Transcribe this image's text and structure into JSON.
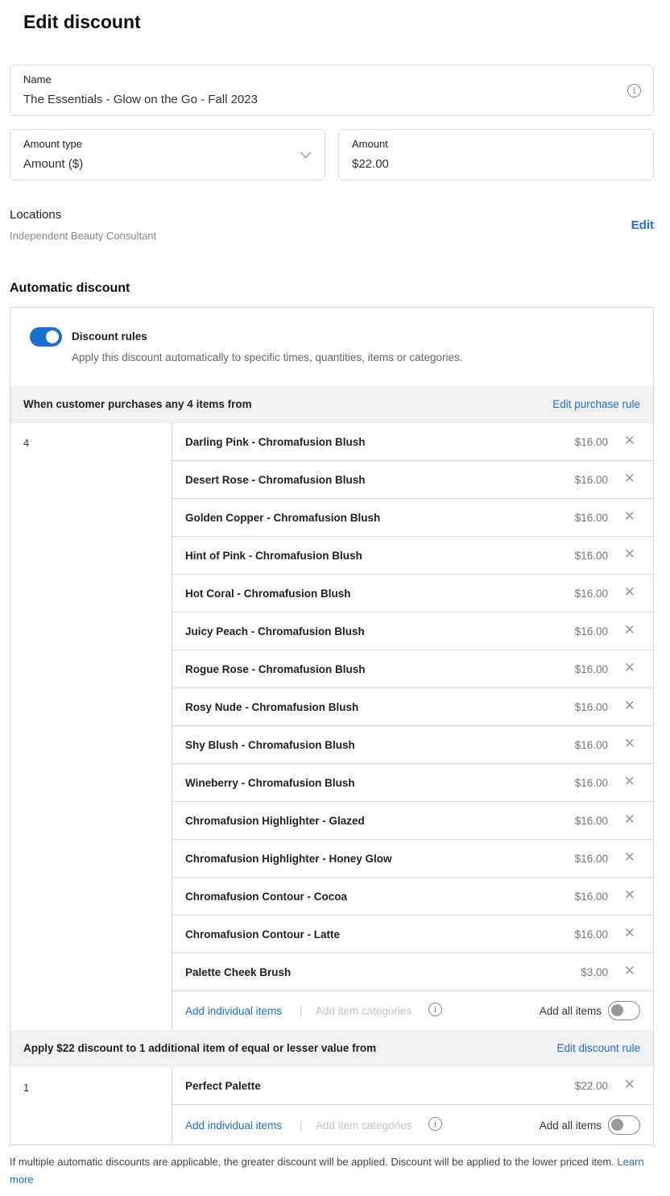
{
  "page": {
    "title": "Edit discount"
  },
  "name_field": {
    "label": "Name",
    "value": "The Essentials - Glow on the Go - Fall 2023"
  },
  "amount_type": {
    "label": "Amount type",
    "value": "Amount ($)"
  },
  "amount": {
    "label": "Amount",
    "value": "$22.00"
  },
  "locations": {
    "title": "Locations",
    "value": "Independent Beauty Consultant",
    "edit_label": "Edit"
  },
  "automatic": {
    "heading": "Automatic discount",
    "rules_label": "Discount rules",
    "rules_desc": "Apply this discount automatically to specific times, quantities, items or categories.",
    "rules_enabled": true
  },
  "purchase_rule": {
    "title": "When customer purchases any 4 items from",
    "edit_label": "Edit purchase rule",
    "quantity": "4",
    "items": [
      {
        "name": "Darling Pink - Chromafusion Blush",
        "price": "$16.00"
      },
      {
        "name": "Desert Rose - Chromafusion Blush",
        "price": "$16.00"
      },
      {
        "name": "Golden Copper - Chromafusion Blush",
        "price": "$16.00"
      },
      {
        "name": "Hint of Pink - Chromafusion Blush",
        "price": "$16.00"
      },
      {
        "name": "Hot Coral - Chromafusion Blush",
        "price": "$16.00"
      },
      {
        "name": "Juicy Peach - Chromafusion Blush",
        "price": "$16.00"
      },
      {
        "name": "Rogue Rose - Chromafusion Blush",
        "price": "$16.00"
      },
      {
        "name": "Rosy Nude - Chromafusion Blush",
        "price": "$16.00"
      },
      {
        "name": "Shy Blush - Chromafusion Blush",
        "price": "$16.00"
      },
      {
        "name": "Wineberry - Chromafusion Blush",
        "price": "$16.00"
      },
      {
        "name": "Chromafusion Highlighter - Glazed",
        "price": "$16.00"
      },
      {
        "name": "Chromafusion Highlighter - Honey Glow",
        "price": "$16.00"
      },
      {
        "name": "Chromafusion Contour - Cocoa",
        "price": "$16.00"
      },
      {
        "name": "Chromafusion Contour - Latte",
        "price": "$16.00"
      },
      {
        "name": "Palette Cheek Brush",
        "price": "$3.00"
      }
    ],
    "add_individual": "Add individual items",
    "add_categories": "Add item categories",
    "add_all": "Add all items",
    "add_all_enabled": false
  },
  "discount_rule": {
    "title": "Apply $22 discount to 1 additional item of equal or lesser value from",
    "edit_label": "Edit discount rule",
    "quantity": "1",
    "items": [
      {
        "name": "Perfect Palette",
        "price": "$22.00"
      }
    ],
    "add_individual": "Add individual items",
    "add_categories": "Add item categories",
    "add_all": "Add all items",
    "add_all_enabled": false
  },
  "footer": {
    "note": "If multiple automatic discounts are applicable, the greater discount will be applied. Discount will be applied to the lower priced item.",
    "learn_more": "Learn more"
  },
  "icons": {
    "info": "info-icon",
    "chevron": "chevron-down-icon",
    "remove": "close-icon"
  },
  "colors": {
    "accent": "#1a6fd6",
    "band": "#f1f1f1",
    "border": "#d6d6d6"
  }
}
